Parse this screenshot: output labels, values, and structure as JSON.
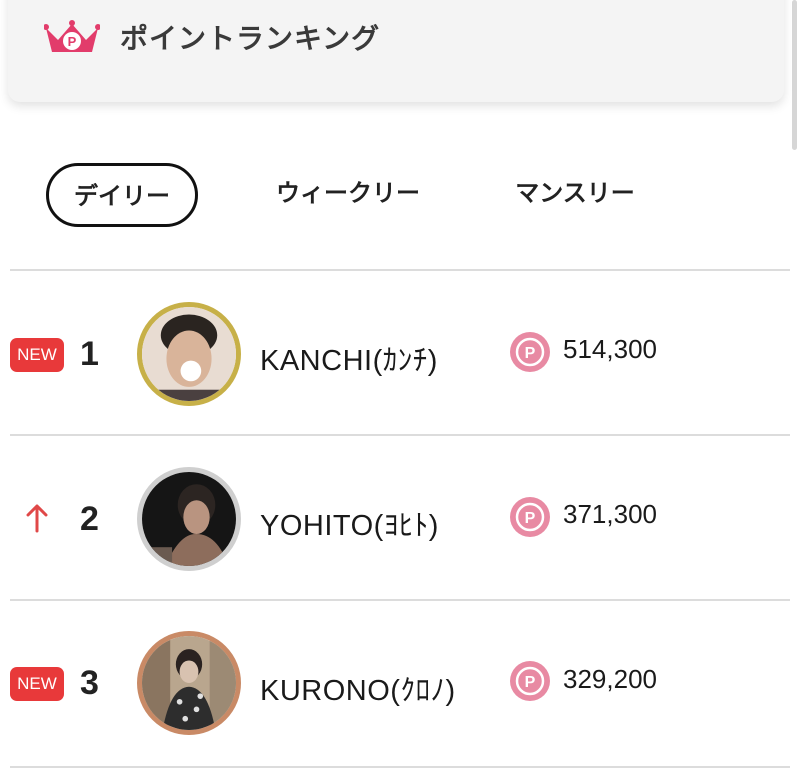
{
  "header": {
    "title": "ポイントランキング",
    "icon": "crown-p-icon",
    "icon_color": "#e23c6b"
  },
  "tabs": [
    {
      "label": "デイリー",
      "active": true
    },
    {
      "label": "ウィークリー",
      "active": false
    },
    {
      "label": "マンスリー",
      "active": false
    }
  ],
  "ranking": [
    {
      "badge": "NEW",
      "trend": "new",
      "rank": "1",
      "name": "KANCHI(ｶﾝﾁ)",
      "points": "514,300",
      "avatar_ring": "#c7b048"
    },
    {
      "badge": "",
      "trend": "up",
      "rank": "2",
      "name": "YOHITO(ﾖﾋﾄ)",
      "points": "371,300",
      "avatar_ring": "#cfcfcf"
    },
    {
      "badge": "NEW",
      "trend": "new",
      "rank": "3",
      "name": "KURONO(ｸﾛﾉ)",
      "points": "329,200",
      "avatar_ring": "#c98a66"
    }
  ],
  "colors": {
    "accent": "#e23c6b",
    "new_badge": "#e8393a",
    "up_arrow": "#e04848",
    "point_coin": "#e88aa3"
  }
}
